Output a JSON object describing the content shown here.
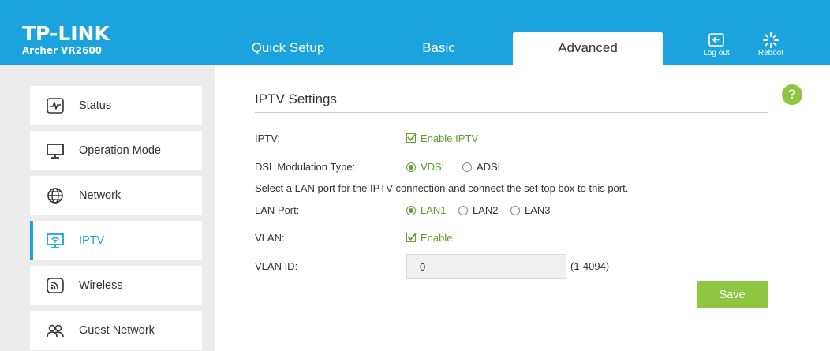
{
  "header": {
    "logo": "TP-LINK",
    "model": "Archer VR2600",
    "tabs": [
      "Quick Setup",
      "Basic",
      "Advanced"
    ],
    "active_tab": "Advanced",
    "logout_label": "Log out",
    "reboot_label": "Reboot",
    "logout_icon": "logout-icon",
    "reboot_icon": "reboot-icon"
  },
  "sidebar": {
    "items": [
      {
        "label": "Status",
        "icon": "status-icon"
      },
      {
        "label": "Operation Mode",
        "icon": "monitor-icon"
      },
      {
        "label": "Network",
        "icon": "globe-icon"
      },
      {
        "label": "IPTV",
        "icon": "iptv-icon",
        "active": true
      },
      {
        "label": "Wireless",
        "icon": "wireless-icon"
      },
      {
        "label": "Guest Network",
        "icon": "guest-network-icon"
      }
    ]
  },
  "main": {
    "help": "?",
    "title": "IPTV Settings",
    "iptv_label": "IPTV:",
    "iptv_checkbox": "Enable IPTV",
    "iptv_checked": true,
    "dsl_label": "DSL Modulation Type:",
    "dsl_options": [
      "VDSL",
      "ADSL"
    ],
    "dsl_selected": "VDSL",
    "description": "Select a LAN port for the IPTV connection and connect the set-top box to this port.",
    "lan_label": "LAN Port:",
    "lan_options": [
      "LAN1",
      "LAN2",
      "LAN3"
    ],
    "lan_selected": "LAN1",
    "vlan_label": "VLAN:",
    "vlan_checkbox": "Enable",
    "vlan_checked": true,
    "vlan_id_label": "VLAN ID:",
    "vlan_id_value": "0",
    "vlan_id_range": "(1-4094)",
    "save_label": "Save"
  },
  "colors": {
    "header": "#1aa3dc",
    "accent_green": "#8ec641",
    "active_text": "#1aa3dc"
  }
}
